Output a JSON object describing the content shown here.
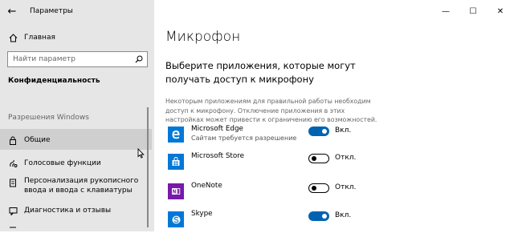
{
  "window": {
    "title": "Параметры",
    "back_glyph": "←",
    "minimize_glyph": "—",
    "maximize_glyph": "☐",
    "close_glyph": "✕"
  },
  "sidebar": {
    "home_label": "Главная",
    "search_placeholder": "Найти параметр",
    "section_privacy": "Конфиденциальность",
    "section_windows_permissions": "Разрешения Windows",
    "items": [
      {
        "label": "Общие",
        "icon": "lock-icon",
        "active": true
      },
      {
        "label": "Голосовые функции",
        "icon": "voice-icon",
        "active": false
      },
      {
        "label": "Персонализация рукописного ввода и ввода с клавиатуры",
        "icon": "pen-icon",
        "active": false
      },
      {
        "label": "Диагностика и отзывы",
        "icon": "feedback-icon",
        "active": false
      }
    ]
  },
  "main": {
    "title": "Микрофон",
    "subtitle": "Выберите приложения, которые могут получать доступ к микрофону",
    "description": "Некоторым приложениям для правильной работы необходим доступ к микрофону. Отключение приложения в этих настройках может привести к ограничению его возможностей.",
    "apps": [
      {
        "name": "Microsoft Edge",
        "sub": "Сайтам требуется разрешение",
        "on": true,
        "state_label": "Вкл.",
        "icon": "edge-icon",
        "color": "#0078d7"
      },
      {
        "name": "Microsoft Store",
        "sub": "",
        "on": false,
        "state_label": "Откл.",
        "icon": "store-icon",
        "color": "#0078d7"
      },
      {
        "name": "OneNote",
        "sub": "",
        "on": false,
        "state_label": "Откл.",
        "icon": "onenote-icon",
        "color": "#7719aa"
      },
      {
        "name": "Skype",
        "sub": "",
        "on": true,
        "state_label": "Вкл.",
        "icon": "skype-icon",
        "color": "#00aff0"
      }
    ]
  },
  "colors": {
    "accent": "#0063b1",
    "sidebar_bg": "#e6e6e6",
    "selected_bg": "#cfcfcf"
  }
}
